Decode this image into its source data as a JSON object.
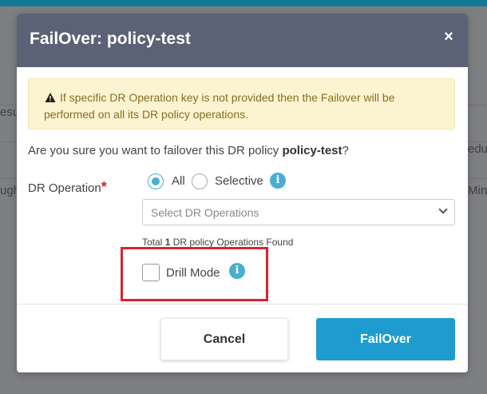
{
  "background": {
    "fragments": [
      "esu",
      "edu",
      "ugh",
      "Min"
    ]
  },
  "dialog": {
    "title": "FailOver: policy-test",
    "close_symbol": "×",
    "warning_text": "If specific DR Operation key is not provided then the Failover will be performed on all its DR policy operations.",
    "confirm_prefix": "Are you sure you want to failover this DR policy ",
    "confirm_policy": "policy-test",
    "confirm_suffix": "?",
    "dr_operation_label": "DR Operation",
    "required_mark": "*",
    "radio_all_label": "All",
    "radio_selective_label": "Selective",
    "selected_option": "All",
    "select_placeholder": "Select DR Operations",
    "total_prefix": "Total ",
    "total_count": "1",
    "total_suffix": " DR policy Operations Found",
    "drill_mode_label": "Drill Mode",
    "drill_mode_checked": false,
    "cancel_label": "Cancel",
    "failover_label": "FailOver"
  },
  "icons": {
    "warning": "warning-triangle-icon",
    "info": "info-icon",
    "close": "close-icon",
    "dropdown": "chevron-down-icon"
  },
  "colors": {
    "header": "#5c6275",
    "primary": "#1e9ccf",
    "warning_bg": "#fcf3d0",
    "highlight": "#d9232d"
  }
}
